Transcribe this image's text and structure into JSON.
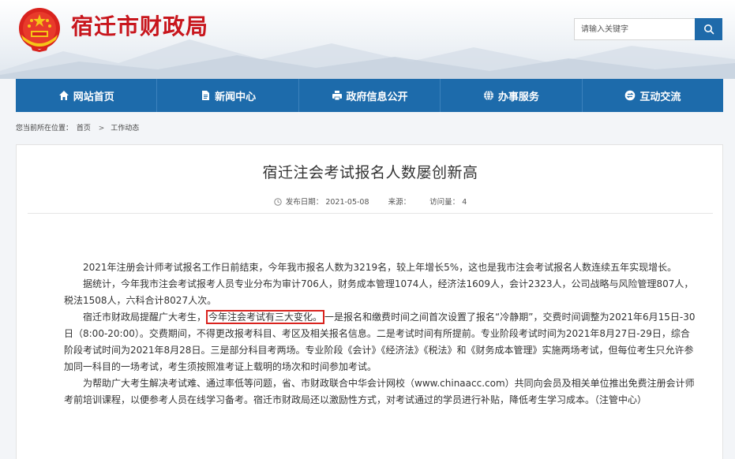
{
  "header": {
    "site_title": "宿迁市财政局",
    "search_placeholder": "请输入关键字",
    "brand_color": "#c8161d",
    "nav_color": "#1d6bab"
  },
  "nav": {
    "items": [
      {
        "label": "网站首页",
        "icon": "home-icon"
      },
      {
        "label": "新闻中心",
        "icon": "document-icon"
      },
      {
        "label": "政府信息公开",
        "icon": "printer-icon"
      },
      {
        "label": "办事服务",
        "icon": "globe-icon"
      },
      {
        "label": "互动交流",
        "icon": "exchange-icon"
      }
    ]
  },
  "breadcrumb": {
    "prefix": "您当前所在位置：",
    "items": [
      "首页",
      "工作动态"
    ],
    "separator": ">"
  },
  "article": {
    "title": "宿迁注会考试报名人数屡创新高",
    "publish_label": "发布日期：",
    "publish_date": "2021-05-08",
    "source_label": "来源：",
    "visits_label": "访问量：",
    "visits": "4",
    "paragraphs": [
      "2021年注册会计师考试报名工作日前结束，今年我市报名人数为3219名，较上年增长5%，这也是我市注会考试报名人数连续五年实现增长。",
      "据统计，今年我市注会考试报考人员专业分布为审计706人，财务成本管理1074人，经济法1609人，会计2323人，公司战略与风险管理807人，税法1508人，六科合计8027人次。"
    ],
    "p3_before": "宿迁市财政局提醒广大考生，",
    "p3_highlight": "今年注会考试有三大变化。",
    "p3_after": "一是报名和缴费时间之间首次设置了报名“冷静期”，交费时间调整为2021年6月15日-30日（8:00-20:00）。交费期间，不得更改报考科目、考区及相关报名信息。二是考试时间有所提前。专业阶段考试时间为2021年8月27日-29日，综合阶段考试时间为2021年8月28日。三是部分科目考两场。专业阶段《会计》《经济法》《税法》和《财务成本管理》实施两场考试，但每位考生只允许参加同一科目的一场考试，考生须按照准考证上载明的场次和时间参加考试。",
    "p4": "为帮助广大考生解决考试难、通过率低等问题，省、市财政联合中华会计网校（www.chinaacc.com）共同向会员及相关单位推出免费注册会计师考前培训课程，以便参考人员在线学习备考。宿迁市财政局还以激励性方式，对考试通过的学员进行补贴，降低考生学习成本。（注管中心）",
    "highlight_color": "#d9231e"
  }
}
